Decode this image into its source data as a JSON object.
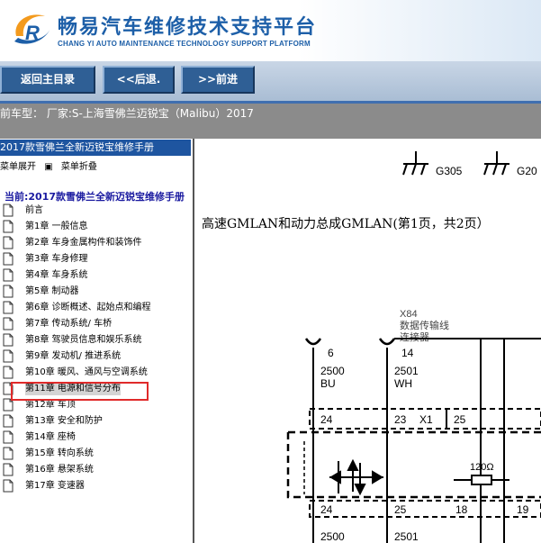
{
  "header": {
    "title_cn": "畅易汽车维修技术支持平台",
    "title_en": "CHANG YI AUTO MAINTENANCE TECHNOLOGY SUPPORT PLATFORM"
  },
  "nav": {
    "back": "返回主目录",
    "prev": "<<后退.",
    "next": ">>前进"
  },
  "info": {
    "vehicle": "前车型： 厂家:S-上海雪佛兰迈锐宝（Malibu）2017"
  },
  "sidebar": {
    "manual_title": "2017款雪佛兰全新迈锐宝维修手册",
    "expand_label": "菜单展开",
    "collapse_label": "菜单折叠",
    "current_label": "当前:2017款雪佛兰全新迈锐宝维修手册",
    "items": [
      {
        "label": "前言"
      },
      {
        "label": "第1章 一般信息"
      },
      {
        "label": "第2章 车身金属构件和装饰件"
      },
      {
        "label": "第3章 车身修理"
      },
      {
        "label": "第4章 车身系统"
      },
      {
        "label": "第5章 制动器"
      },
      {
        "label": "第6章 诊断概述、起始点和编程"
      },
      {
        "label": "第7章 传动系统/ 车桥"
      },
      {
        "label": "第8章 驾驶员信息和娱乐系统"
      },
      {
        "label": "第9章 发动机/ 推进系统"
      },
      {
        "label": "第10章 暖风、通风与空调系统"
      },
      {
        "label": "第11章 电源和信号分布"
      },
      {
        "label": "第12章 车顶"
      },
      {
        "label": "第13章 安全和防护"
      },
      {
        "label": "第14章 座椅"
      },
      {
        "label": "第15章 转向系统"
      },
      {
        "label": "第16章 悬架系统"
      },
      {
        "label": "第17章 变速器"
      }
    ]
  },
  "content": {
    "page_caption": "高速GMLAN和动力总成GMLAN(第1页，共2页）",
    "ground_1": "G305",
    "ground_2": "G20",
    "connector_id": "X84",
    "connector_name_1": "数据传输线",
    "connector_name_2": "连接器",
    "pin_a": "6",
    "pin_b": "14",
    "wire_a_num": "2500",
    "wire_a_color": "BU",
    "wire_b_num": "2501",
    "wire_b_color": "WH",
    "term_24_top": "24",
    "term_23": "23",
    "term_x1": "X1",
    "term_25_top": "25",
    "resistor": "120Ω",
    "term_24_bot": "24",
    "term_25_bot": "25",
    "term_18": "18",
    "term_19": "19",
    "wire_c_num": "2500",
    "wire_d_num": "2501"
  },
  "colors": {
    "header_blue": "#1d5fa8",
    "nav_button": "#2f5f95",
    "sidebar_head": "#1e55a0",
    "highlight_border": "#e02a2a",
    "infobar_bg": "#8b8b8b"
  }
}
